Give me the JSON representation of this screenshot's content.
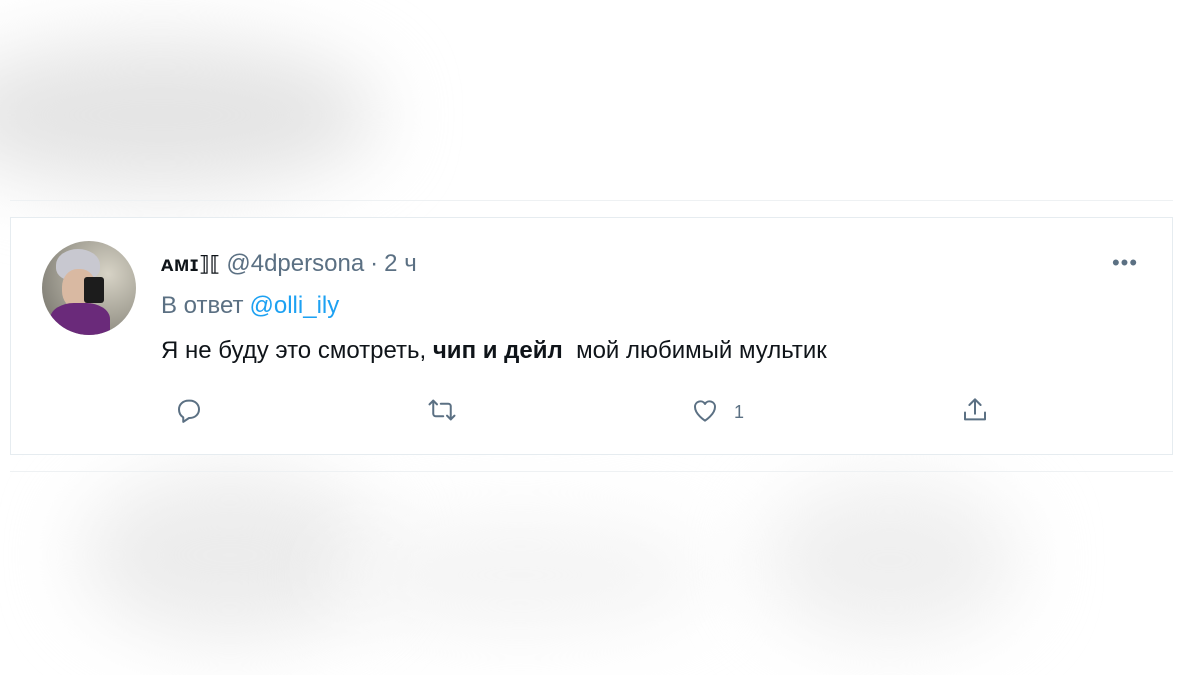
{
  "tweet": {
    "display_name": "ᴀᴍɪ⟧⟦",
    "handle": "@4dpersona",
    "separator": "·",
    "time": "2 ч",
    "reply_prefix": "В ответ",
    "reply_to": "@olli_ily",
    "text_before": "Я не буду это смотреть, ",
    "text_bold": "чип и дейл",
    "text_after": "  мой любимый мультик",
    "more_label": "•••",
    "likes_count": "1"
  },
  "icons": {
    "reply": "reply-icon",
    "retweet": "retweet-icon",
    "like": "heart-icon",
    "share": "share-icon"
  },
  "colors": {
    "link": "#1da1f2",
    "secondary_text": "#5b7083",
    "primary_text": "#0f1419"
  }
}
